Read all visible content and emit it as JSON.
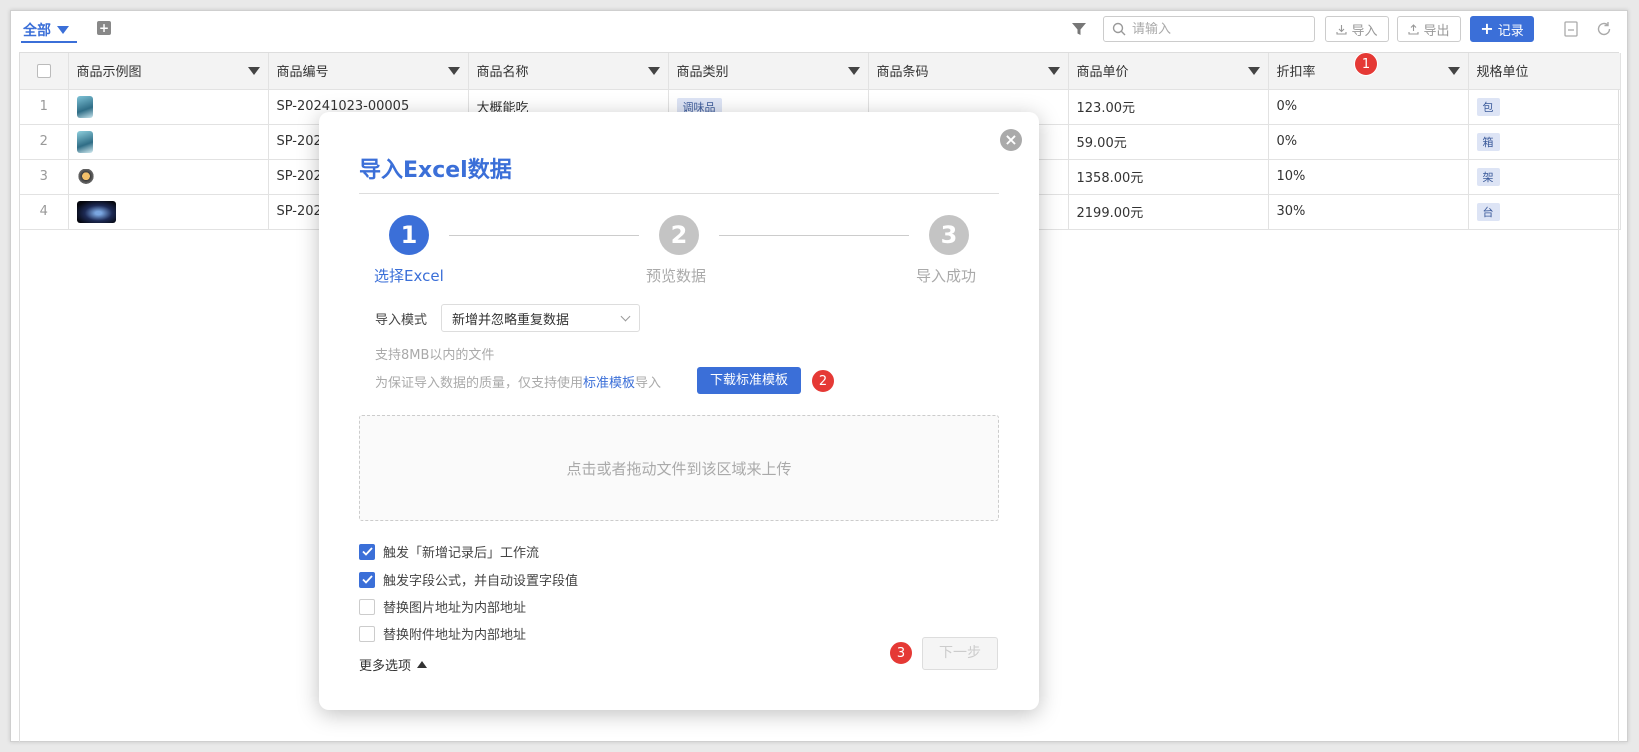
{
  "toolbar": {
    "view_tab": "全部",
    "search_placeholder": "请输入",
    "import_label": "导入",
    "export_label": "导出",
    "record_label": "记录"
  },
  "table": {
    "columns": [
      "商品示例图",
      "商品编号",
      "商品名称",
      "商品类别",
      "商品条码",
      "商品单价",
      "折扣率",
      "规格单位"
    ],
    "rows": [
      {
        "idx": "1",
        "code": "SP-20241023-00005",
        "name": "大概能吃",
        "category": "调味品",
        "barcode": "",
        "price": "123.00元",
        "discount": "0%",
        "unit": "包"
      },
      {
        "idx": "2",
        "code": "SP-202",
        "name": "",
        "category": "",
        "barcode": "",
        "price": "59.00元",
        "discount": "0%",
        "unit": "箱"
      },
      {
        "idx": "3",
        "code": "SP-202",
        "name": "",
        "category": "",
        "barcode": "",
        "price": "1358.00元",
        "discount": "10%",
        "unit": "架"
      },
      {
        "idx": "4",
        "code": "SP-202",
        "name": "",
        "category": "",
        "barcode": "",
        "price": "2199.00元",
        "discount": "30%",
        "unit": "台"
      }
    ]
  },
  "modal": {
    "title": "导入Excel数据",
    "close": "×",
    "steps": [
      {
        "num": "1",
        "label": "选择Excel"
      },
      {
        "num": "2",
        "label": "预览数据"
      },
      {
        "num": "3",
        "label": "导入成功"
      }
    ],
    "mode_label": "导入模式",
    "mode_value": "新增并忽略重复数据",
    "hint_size": "支持8MB以内的文件",
    "hint_quality_prefix": "为保证导入数据的质量，仅支持使用",
    "hint_quality_link": "标准模板",
    "hint_quality_suffix": "导入",
    "download_template": "下载标准模板",
    "dropzone_text": "点击或者拖动文件到该区域来上传",
    "options": [
      {
        "label": "触发「新增记录后」工作流",
        "checked": true
      },
      {
        "label": "触发字段公式，并自动设置字段值",
        "checked": true
      },
      {
        "label": "替换图片地址为内部地址",
        "checked": false
      },
      {
        "label": "替换附件地址为内部地址",
        "checked": false
      }
    ],
    "more_options": "更多选项",
    "next": "下一步"
  },
  "badges": [
    "1",
    "2",
    "3"
  ],
  "colors": {
    "accent": "#3b6fd8",
    "badge": "#e53935",
    "step_inactive": "#c4c4c4"
  }
}
